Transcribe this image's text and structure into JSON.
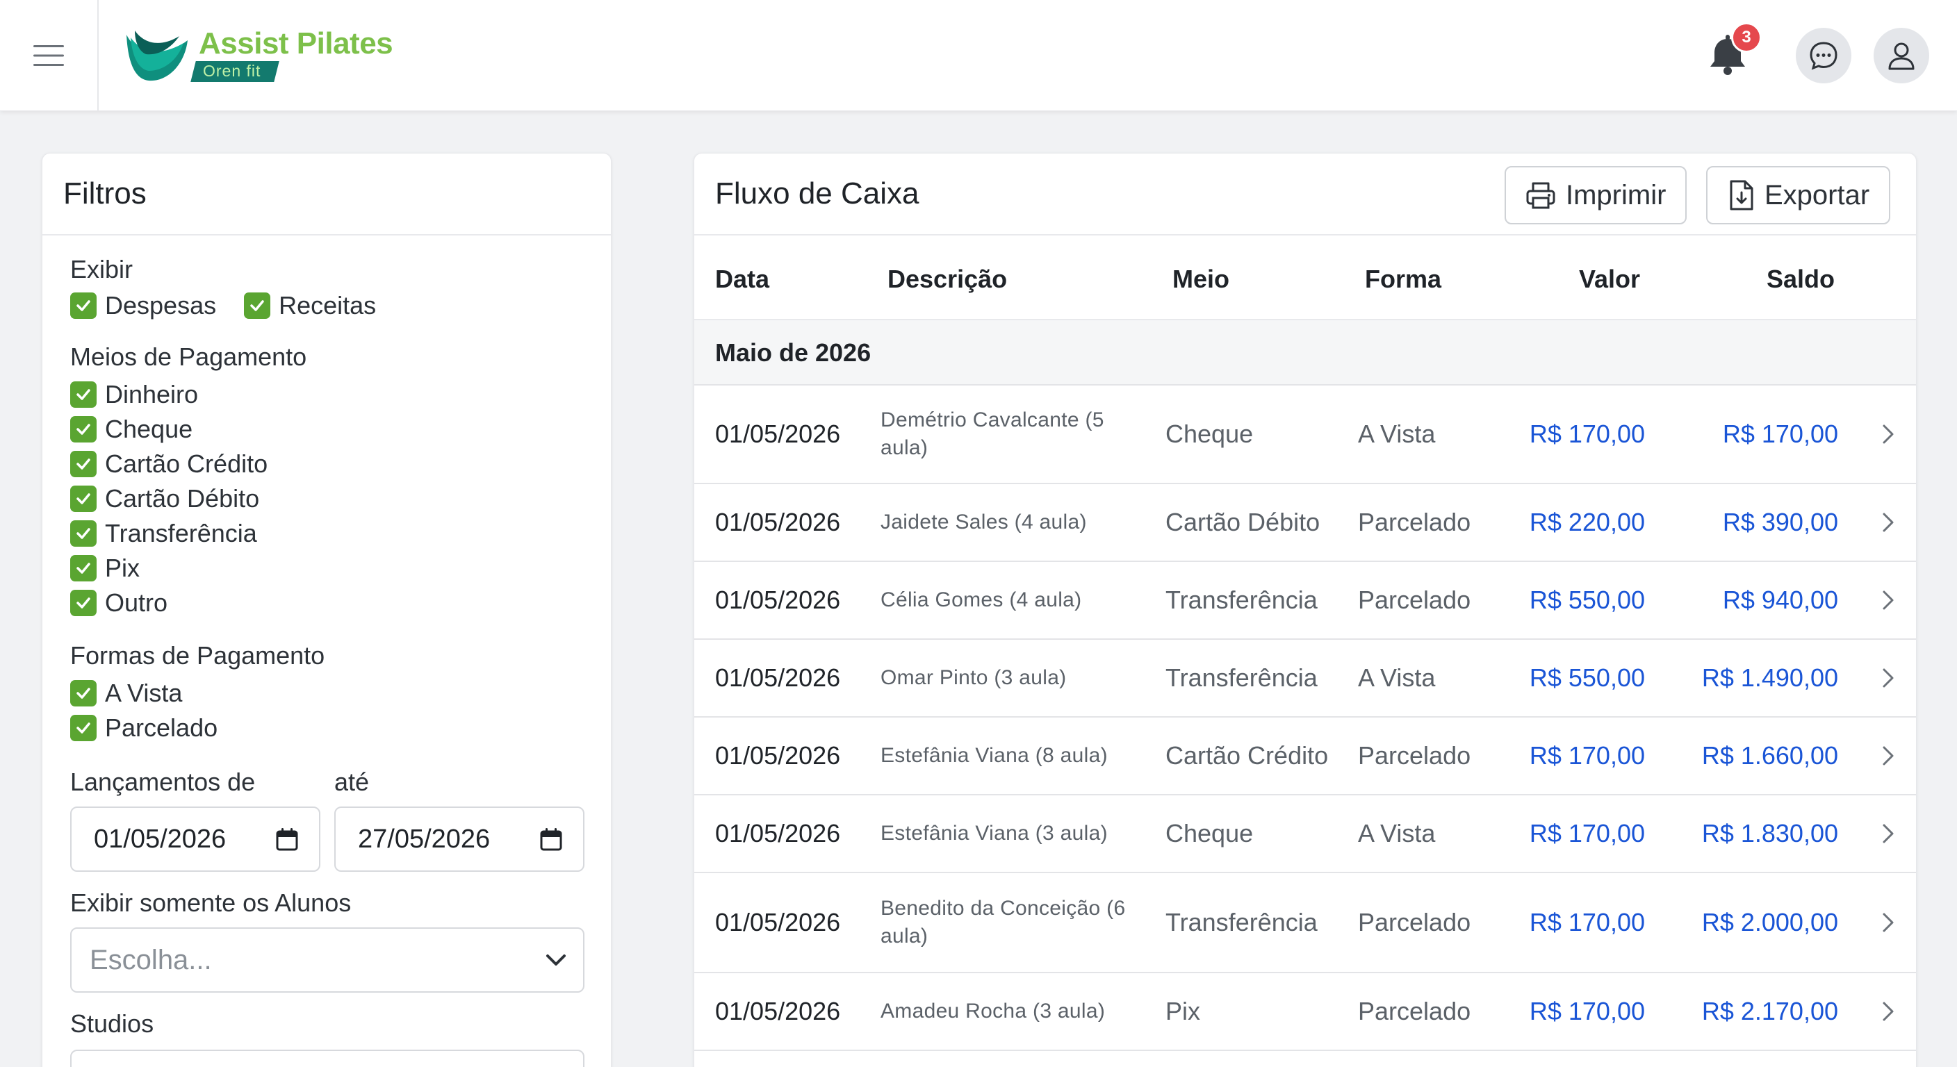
{
  "app": {
    "brand": "Assist Pilates",
    "brand_tag": "Oren fit",
    "notification_count": "3",
    "colors": {
      "brand_green": "#7dc04a",
      "brand_teal": "#137a6e",
      "check_green": "#5aa531",
      "value_blue": "#1a55d6",
      "badge_red": "#e5484d"
    }
  },
  "filters": {
    "title": "Filtros",
    "exibir": {
      "label": "Exibir",
      "options": [
        "Despesas",
        "Receitas"
      ]
    },
    "meios": {
      "label": "Meios de Pagamento",
      "options": [
        "Dinheiro",
        "Cheque",
        "Cartão Crédito",
        "Cartão Débito",
        "Transferência",
        "Pix",
        "Outro"
      ]
    },
    "formas": {
      "label": "Formas de Pagamento",
      "options": [
        "A Vista",
        "Parcelado"
      ]
    },
    "lancamentos": {
      "from_label": "Lançamentos de",
      "to_label": "até",
      "from_value": "01/05/2026",
      "to_value": "27/05/2026"
    },
    "alunos": {
      "label": "Exibir somente os Alunos",
      "placeholder": "Escolha..."
    },
    "studios": {
      "label": "Studios"
    }
  },
  "cashflow": {
    "title": "Fluxo de Caixa",
    "print_label": "Imprimir",
    "export_label": "Exportar",
    "columns": [
      "Data",
      "Descrição",
      "Meio",
      "Forma",
      "Valor",
      "Saldo"
    ],
    "group_label": "Maio de 2026",
    "rows": [
      {
        "date": "01/05/2026",
        "desc": "Demétrio Cavalcante (5 aula)",
        "meio": "Cheque",
        "forma": "A Vista",
        "valor": "R$ 170,00",
        "saldo": "R$ 170,00"
      },
      {
        "date": "01/05/2026",
        "desc": "Jaidete Sales (4 aula)",
        "meio": "Cartão Débito",
        "forma": "Parcelado",
        "valor": "R$ 220,00",
        "saldo": "R$ 390,00"
      },
      {
        "date": "01/05/2026",
        "desc": "Célia Gomes (4 aula)",
        "meio": "Transferência",
        "forma": "Parcelado",
        "valor": "R$ 550,00",
        "saldo": "R$ 940,00"
      },
      {
        "date": "01/05/2026",
        "desc": "Omar Pinto (3 aula)",
        "meio": "Transferência",
        "forma": "A Vista",
        "valor": "R$ 550,00",
        "saldo": "R$ 1.490,00"
      },
      {
        "date": "01/05/2026",
        "desc": "Estefânia Viana (8 aula)",
        "meio": "Cartão Crédito",
        "forma": "Parcelado",
        "valor": "R$ 170,00",
        "saldo": "R$ 1.660,00"
      },
      {
        "date": "01/05/2026",
        "desc": "Estefânia Viana (3 aula)",
        "meio": "Cheque",
        "forma": "A Vista",
        "valor": "R$ 170,00",
        "saldo": "R$ 1.830,00"
      },
      {
        "date": "01/05/2026",
        "desc": "Benedito da Conceição (6 aula)",
        "meio": "Transferência",
        "forma": "Parcelado",
        "valor": "R$ 170,00",
        "saldo": "R$ 2.000,00"
      },
      {
        "date": "01/05/2026",
        "desc": "Amadeu Rocha (3 aula)",
        "meio": "Pix",
        "forma": "Parcelado",
        "valor": "R$ 170,00",
        "saldo": "R$ 2.170,00"
      }
    ]
  }
}
